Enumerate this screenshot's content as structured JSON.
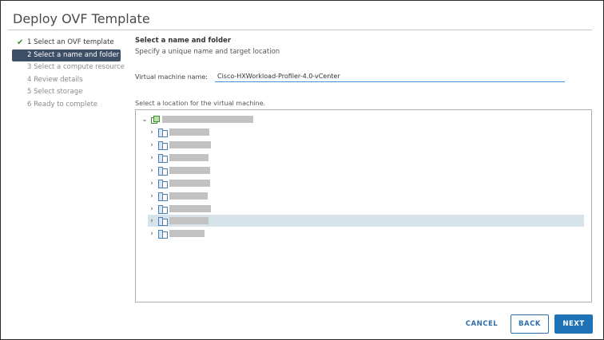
{
  "window": {
    "title": "Deploy OVF Template"
  },
  "steps": [
    {
      "label": "1 Select an OVF template",
      "state": "done"
    },
    {
      "label": "2 Select a name and folder",
      "state": "active"
    },
    {
      "label": "3 Select a compute resource",
      "state": "pending"
    },
    {
      "label": "4 Review details",
      "state": "pending"
    },
    {
      "label": "5 Select storage",
      "state": "pending"
    },
    {
      "label": "6 Ready to complete",
      "state": "pending"
    }
  ],
  "main": {
    "heading": "Select a name and folder",
    "subheading": "Specify a unique name and target location",
    "vm_name_label": "Virtual machine name:",
    "vm_name_value": "Cisco-HXWorkload-Profiler-4.0-vCenter",
    "location_label": "Select a location for the virtual machine."
  },
  "tree": {
    "root": {
      "icon": "datacenter-icon",
      "expanded": true,
      "label_redacted": true
    },
    "children": [
      {
        "icon": "datacenter-folder-icon",
        "expanded": false,
        "label_redacted": true,
        "selected": false
      },
      {
        "icon": "datacenter-folder-icon",
        "expanded": false,
        "label_redacted": true,
        "selected": false
      },
      {
        "icon": "datacenter-folder-icon",
        "expanded": false,
        "label_redacted": true,
        "selected": false
      },
      {
        "icon": "datacenter-folder-icon",
        "expanded": false,
        "label_redacted": true,
        "selected": false
      },
      {
        "icon": "datacenter-folder-icon",
        "expanded": false,
        "label_redacted": true,
        "selected": false
      },
      {
        "icon": "datacenter-folder-icon",
        "expanded": false,
        "label_redacted": true,
        "selected": false
      },
      {
        "icon": "datacenter-folder-icon",
        "expanded": false,
        "label_redacted": true,
        "selected": false
      },
      {
        "icon": "datacenter-folder-icon",
        "expanded": false,
        "label_redacted": true,
        "selected": true
      },
      {
        "icon": "datacenter-folder-icon",
        "expanded": false,
        "label_redacted": true,
        "selected": false
      }
    ]
  },
  "footer": {
    "cancel_label": "CANCEL",
    "back_label": "BACK",
    "next_label": "NEXT"
  },
  "colors": {
    "accent": "#1f72b5",
    "active_step_bg": "#3d4f66",
    "check": "#3f8f2e",
    "selected_row": "#d7e3ea"
  }
}
